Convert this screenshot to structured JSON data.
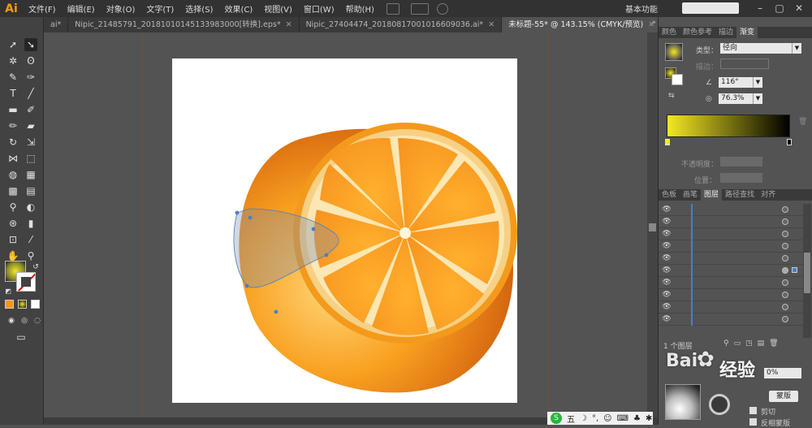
{
  "app": {
    "logo": "Ai"
  },
  "menu": [
    "文件(F)",
    "编辑(E)",
    "对象(O)",
    "文字(T)",
    "选择(S)",
    "效果(C)",
    "视图(V)",
    "窗口(W)",
    "帮助(H)"
  ],
  "workspace_label": "基本功能",
  "tabs": [
    {
      "label": "ai*",
      "active": false
    },
    {
      "label": "Nipic_21485791_20181010145133983000[转换].eps*",
      "active": false
    },
    {
      "label": "Nipic_27404474_20180817001016609036.ai*",
      "active": false
    },
    {
      "label": "未标题-55* @ 143.15% (CMYK/预览)",
      "active": true
    }
  ],
  "tab_overflow": "»",
  "panel_top": {
    "tabs": [
      "颜色",
      "颜色参考",
      "描边",
      "渐变"
    ],
    "active_tab": "渐变",
    "type_label": "类型：",
    "type_value": "径向",
    "stroke_label": "描边：",
    "angle_value": "116°",
    "ratio_value": "76.3%",
    "opacity_label": "不透明度：",
    "position_label": "位置："
  },
  "panel_layers": {
    "tabs": [
      "色板",
      "画笔",
      "图层",
      "路径查找",
      "对齐"
    ],
    "active_tab": "图层",
    "footer_label": "1 个图层"
  },
  "panel_bottom": {
    "mask_button": "蒙版",
    "clip_label": "剪切",
    "invert_label": "反相蒙版",
    "opacity_value": "0%"
  },
  "watermark": {
    "text": "经验",
    "baidu": "Bai"
  },
  "taskbar": {
    "ime_label": "五"
  },
  "colors": {
    "accent": "#ff9a00",
    "gradient_start": "#f4e823",
    "gradient_end": "#000000",
    "orange": "#f7931e",
    "guide": "#c42b2b"
  }
}
